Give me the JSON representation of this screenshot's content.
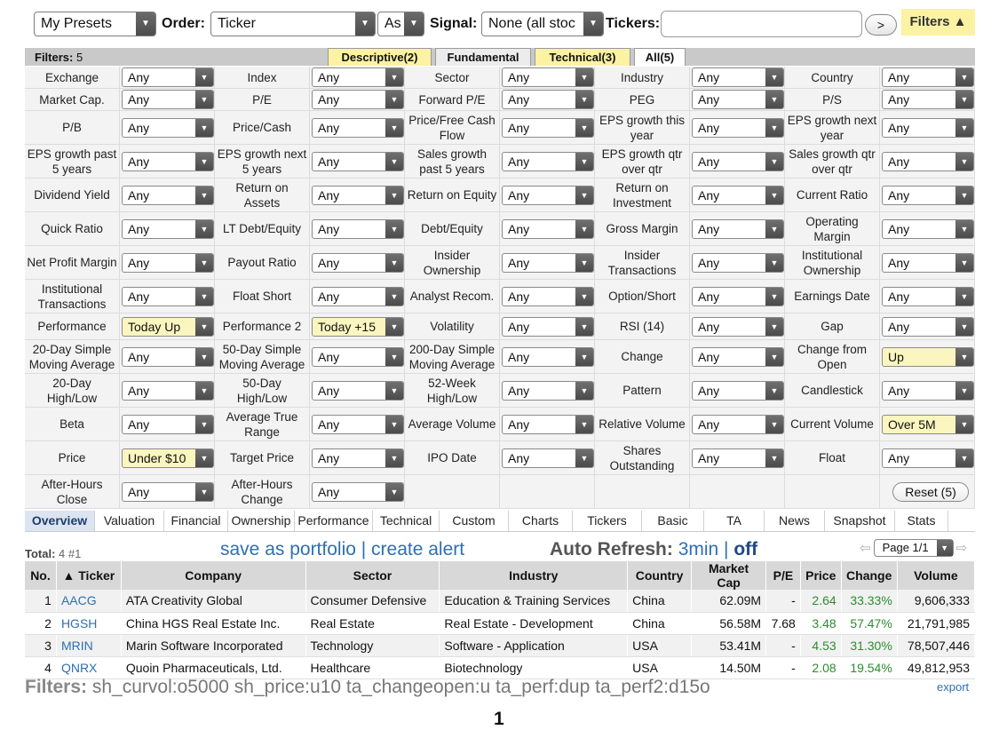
{
  "toolbar": {
    "presets": "My Presets",
    "order_label": "Order:",
    "order_value": "Ticker",
    "order_dir": "As",
    "signal_label": "Signal:",
    "signal_value": "None (all stoc",
    "tickers_label": "Tickers:",
    "tickers_value": "",
    "go_label": ">",
    "filters_tab": "Filters ▲"
  },
  "filter_header": {
    "count_label": "Filters:",
    "count_value": "5",
    "tabs": [
      "Descriptive(2)",
      "Fundamental",
      "Technical(3)",
      "All(5)"
    ]
  },
  "filters": [
    [
      "Exchange",
      "Any",
      "Index",
      "Any",
      "Sector",
      "Any",
      "Industry",
      "Any",
      "Country",
      "Any"
    ],
    [
      "Market Cap.",
      "Any",
      "P/E",
      "Any",
      "Forward P/E",
      "Any",
      "PEG",
      "Any",
      "P/S",
      "Any"
    ],
    [
      "P/B",
      "Any",
      "Price/Cash",
      "Any",
      "Price/Free Cash Flow",
      "Any",
      "EPS growth this year",
      "Any",
      "EPS growth next year",
      "Any"
    ],
    [
      "EPS growth past 5 years",
      "Any",
      "EPS growth next 5 years",
      "Any",
      "Sales growth past 5 years",
      "Any",
      "EPS growth qtr over qtr",
      "Any",
      "Sales growth qtr over qtr",
      "Any"
    ],
    [
      "Dividend Yield",
      "Any",
      "Return on Assets",
      "Any",
      "Return on Equity",
      "Any",
      "Return on Investment",
      "Any",
      "Current Ratio",
      "Any"
    ],
    [
      "Quick Ratio",
      "Any",
      "LT Debt/Equity",
      "Any",
      "Debt/Equity",
      "Any",
      "Gross Margin",
      "Any",
      "Operating Margin",
      "Any"
    ],
    [
      "Net Profit Margin",
      "Any",
      "Payout Ratio",
      "Any",
      "Insider Ownership",
      "Any",
      "Insider Transactions",
      "Any",
      "Institutional Ownership",
      "Any"
    ],
    [
      "Institutional Transactions",
      "Any",
      "Float Short",
      "Any",
      "Analyst Recom.",
      "Any",
      "Option/Short",
      "Any",
      "Earnings Date",
      "Any"
    ],
    [
      "Performance",
      "Today Up",
      "Performance 2",
      "Today +15",
      "Volatility",
      "Any",
      "RSI (14)",
      "Any",
      "Gap",
      "Any"
    ],
    [
      "20-Day Simple Moving Average",
      "Any",
      "50-Day Simple Moving Average",
      "Any",
      "200-Day Simple Moving Average",
      "Any",
      "Change",
      "Any",
      "Change from Open",
      "Up"
    ],
    [
      "20-Day High/Low",
      "Any",
      "50-Day High/Low",
      "Any",
      "52-Week High/Low",
      "Any",
      "Pattern",
      "Any",
      "Candlestick",
      "Any"
    ],
    [
      "Beta",
      "Any",
      "Average True Range",
      "Any",
      "Average Volume",
      "Any",
      "Relative Volume",
      "Any",
      "Current Volume",
      "Over 5M"
    ],
    [
      "Price",
      "Under $10",
      "Target Price",
      "Any",
      "IPO Date",
      "Any",
      "Shares Outstanding",
      "Any",
      "Float",
      "Any"
    ],
    [
      "After-Hours Close",
      "Any",
      "After-Hours Change",
      "Any",
      "",
      "",
      "",
      "",
      "",
      ""
    ]
  ],
  "reset_label": "Reset (5)",
  "view_tabs": [
    "Overview",
    "Valuation",
    "Financial",
    "Ownership",
    "Performance",
    "Technical",
    "Custom",
    "Charts",
    "Tickers",
    "Basic",
    "TA",
    "News",
    "Snapshot",
    "Stats"
  ],
  "total": {
    "label": "Total:",
    "value": "4 #1"
  },
  "links": {
    "portfolio": "save as portfolio",
    "sep": " | ",
    "alert": "create alert"
  },
  "auto_refresh": {
    "label": "Auto Refresh:",
    "interval": "3min",
    "sep": " | ",
    "off": "off"
  },
  "pager": {
    "value": "Page 1/1"
  },
  "table": {
    "headers": [
      "No.",
      "▲ Ticker",
      "Company",
      "Sector",
      "Industry",
      "Country",
      "Market Cap",
      "P/E",
      "Price",
      "Change",
      "Volume"
    ],
    "rows": [
      [
        "1",
        "AACG",
        "ATA Creativity Global",
        "Consumer Defensive",
        "Education & Training Services",
        "China",
        "62.09M",
        "-",
        "2.64",
        "33.33%",
        "9,606,333"
      ],
      [
        "2",
        "HGSH",
        "China HGS Real Estate Inc.",
        "Real Estate",
        "Real Estate - Development",
        "China",
        "56.58M",
        "7.68",
        "3.48",
        "57.47%",
        "21,791,985"
      ],
      [
        "3",
        "MRIN",
        "Marin Software Incorporated",
        "Technology",
        "Software - Application",
        "USA",
        "53.41M",
        "-",
        "4.53",
        "31.30%",
        "78,507,446"
      ],
      [
        "4",
        "QNRX",
        "Quoin Pharmaceuticals, Ltd.",
        "Healthcare",
        "Biotechnology",
        "USA",
        "14.50M",
        "-",
        "2.08",
        "19.54%",
        "49,812,953"
      ]
    ]
  },
  "footer": {
    "filters_label": "Filters:",
    "filters_value": "sh_curvol:o5000 sh_price:u10 ta_changeopen:u ta_perf:dup ta_perf2:d15o",
    "export": "export",
    "page_number": "1"
  },
  "colors": {
    "highlight": "#fbf6bf",
    "tab_highlight": "#fbf2a3",
    "link": "#2e6fb3",
    "positive": "#2e8b2e"
  }
}
